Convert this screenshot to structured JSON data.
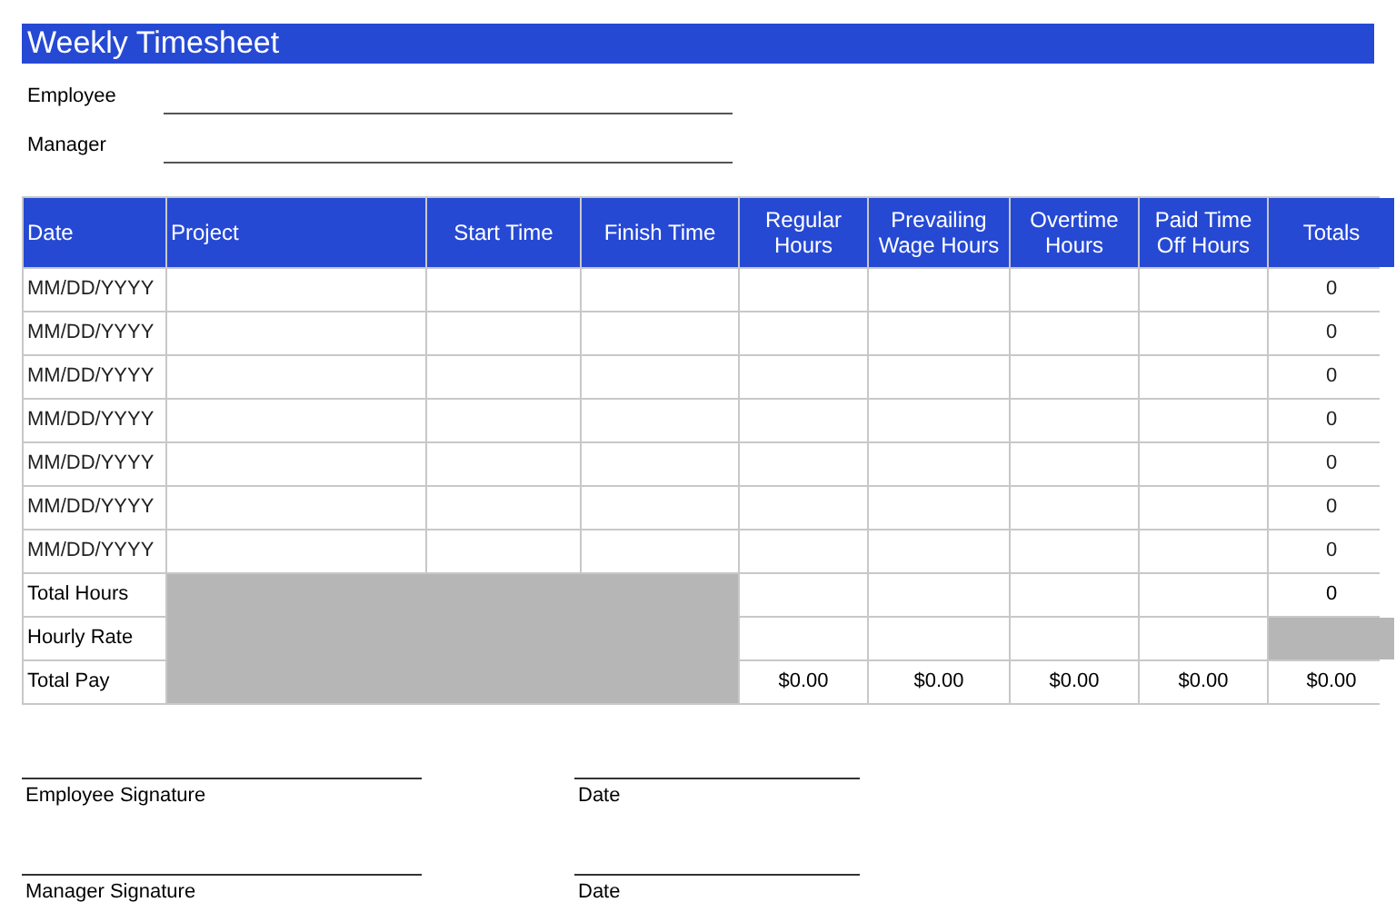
{
  "title": "Weekly Timesheet",
  "fields": [
    {
      "label": "Employee"
    },
    {
      "label": "Manager"
    }
  ],
  "table": {
    "columns": [
      "Date",
      "Project",
      "Start Time",
      "Finish Time",
      "Regular Hours",
      "Prevailing Wage Hours",
      "Overtime Hours",
      "Paid Time Off Hours",
      "Totals"
    ],
    "rows": [
      {
        "date": "MM/DD/YYYY",
        "total": "0"
      },
      {
        "date": "MM/DD/YYYY",
        "total": "0"
      },
      {
        "date": "MM/DD/YYYY",
        "total": "0"
      },
      {
        "date": "MM/DD/YYYY",
        "total": "0"
      },
      {
        "date": "MM/DD/YYYY",
        "total": "0"
      },
      {
        "date": "MM/DD/YYYY",
        "total": "0"
      },
      {
        "date": "MM/DD/YYYY",
        "total": "0"
      }
    ],
    "summary": [
      {
        "label": "Total Hours",
        "total": "0",
        "total_shaded": false
      },
      {
        "label": "Hourly Rate",
        "total_shaded": true
      },
      {
        "label": "Total Pay",
        "amounts": [
          "$0.00",
          "$0.00",
          "$0.00",
          "$0.00"
        ],
        "total": "$0.00",
        "total_shaded": false
      }
    ]
  },
  "signatures": [
    {
      "label": "Employee Signature",
      "date_label": "Date"
    },
    {
      "label": "Manager Signature",
      "date_label": "Date"
    }
  ]
}
